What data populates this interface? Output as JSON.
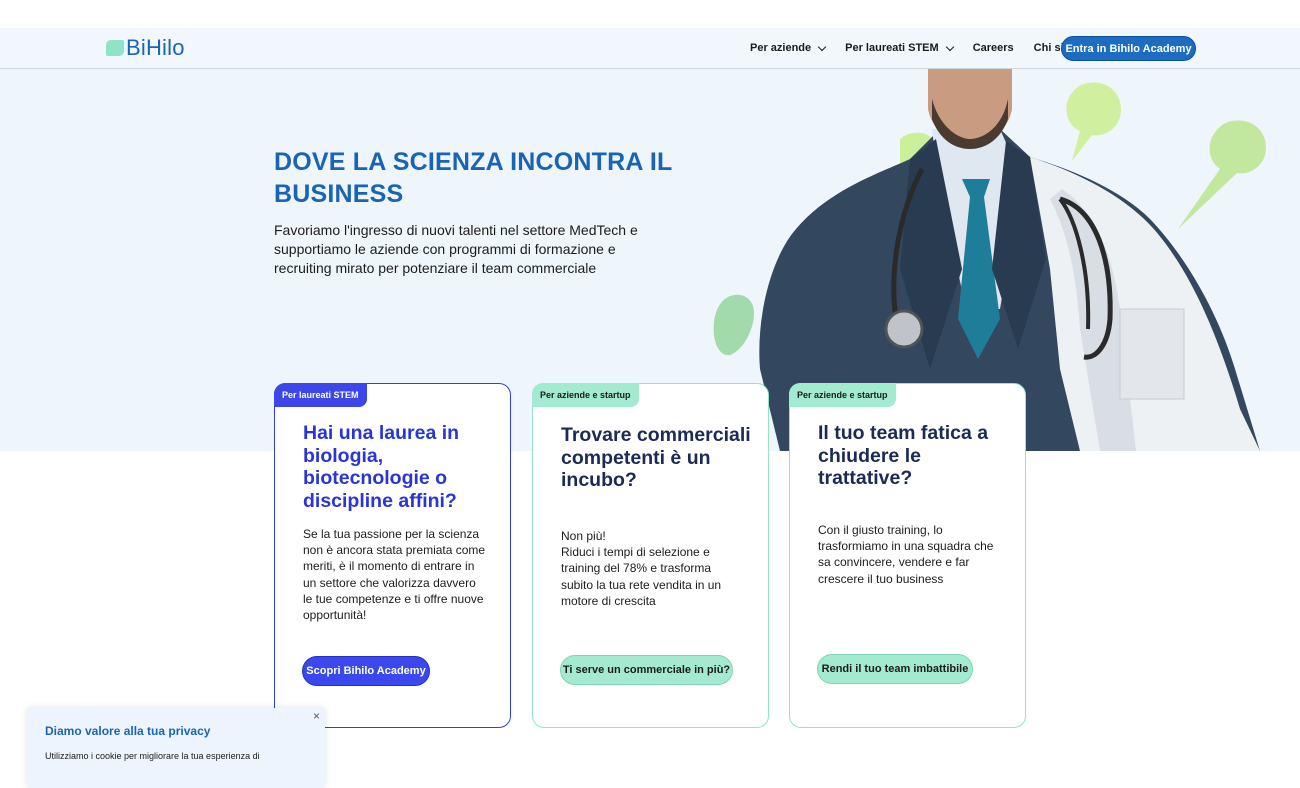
{
  "brand": {
    "name": "BiHilo"
  },
  "nav": {
    "items": [
      {
        "label": "Per aziende",
        "dropdown": true
      },
      {
        "label": "Per laureati STEM",
        "dropdown": true
      },
      {
        "label": "Careers",
        "dropdown": false
      },
      {
        "label": "Chi siamo",
        "dropdown": false
      }
    ],
    "cta": "Entra in Bihilo Academy"
  },
  "hero": {
    "title": "DOVE LA SCIENZA INCONTRA IL BUSINESS",
    "subtitle": "Favoriamo l'ingresso di nuovi talenti nel settore MedTech e supportiamo le aziende con programmi di formazione e recruiting mirato per potenziare il team commerciale"
  },
  "cards": [
    {
      "tag": "Per laureati STEM",
      "title": "Hai una laurea in biologia, biotecnologie o discipline affini?",
      "body": "Se la tua passione per la scienza non è ancora stata premiata come meriti, è il momento di entrare in un settore che valorizza davvero le tue competenze e ti offre nuove opportunità!",
      "button": "Scopri Bihilo Academy"
    },
    {
      "tag": "Per aziende e startup",
      "title": "Trovare commerciali competenti è un incubo?",
      "body_line1": "Non più!",
      "body_line2": "Riduci i tempi di selezione e training del 78% e trasforma subito la tua rete vendita in un motore di crescita",
      "button": "Ti serve un commerciale in più?"
    },
    {
      "tag": "Per aziende e startup",
      "title": "Il tuo team fatica a chiudere le trattative?",
      "body": "Con il giusto training, lo trasformiamo in una squadra che sa convincere, vendere e far crescere il tuo business",
      "button": "Rendi il tuo team imbattibile"
    }
  ],
  "privacy": {
    "title": "Diamo valore alla tua privacy",
    "text": "Utilizziamo i cookie per migliorare la tua esperienza di",
    "close": "×"
  },
  "colors": {
    "brand_blue": "#1a64b4",
    "accent_indigo": "#3b48ee",
    "accent_mint": "#a3ead0",
    "hero_bg": "#eef5fb"
  }
}
